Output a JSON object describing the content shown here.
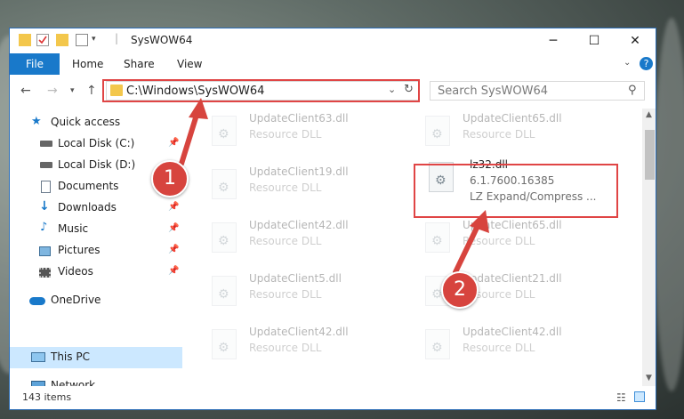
{
  "window": {
    "title": "SysWOW64"
  },
  "ribbon": {
    "tabs": [
      "File",
      "Home",
      "Share",
      "View"
    ]
  },
  "address": {
    "path": "C:\\Windows\\SysWOW64"
  },
  "search": {
    "placeholder": "Search SysWOW64"
  },
  "sidebar": {
    "items": [
      {
        "label": "Quick access",
        "icon": "star-icon"
      },
      {
        "label": "Local Disk (C:)",
        "icon": "drive-icon",
        "pinned": true
      },
      {
        "label": "Local Disk (D:)",
        "icon": "drive-icon"
      },
      {
        "label": "Documents",
        "icon": "documents-icon",
        "pinned": true
      },
      {
        "label": "Downloads",
        "icon": "download-arrow-icon",
        "pinned": true
      },
      {
        "label": "Music",
        "icon": "music-note-icon",
        "pinned": true
      },
      {
        "label": "Pictures",
        "icon": "pictures-icon",
        "pinned": true
      },
      {
        "label": "Videos",
        "icon": "film-icon",
        "pinned": true
      },
      {
        "label": "OneDrive",
        "icon": "cloud-icon"
      },
      {
        "label": "This PC",
        "icon": "monitor-icon",
        "selected": true
      },
      {
        "label": "Network",
        "icon": "network-icon"
      }
    ]
  },
  "files": {
    "left": [
      {
        "name": "UpdateClient63.dll",
        "type": "Resource DLL"
      },
      {
        "name": "UpdateClient19.dll",
        "type": "Resource DLL"
      },
      {
        "name": "UpdateClient42.dll",
        "type": "Resource DLL"
      },
      {
        "name": "UpdateClient5.dll",
        "type": "Resource DLL"
      },
      {
        "name": "UpdateClient42.dll",
        "type": "Resource DLL"
      }
    ],
    "right": [
      {
        "name": "UpdateClient65.dll",
        "type": "Resource DLL"
      },
      {
        "name": "lz32.dll",
        "version": "6.1.7600.16385",
        "type": "LZ Expand/Compress ..."
      },
      {
        "name": "UpdateClient65.dll",
        "type": "Resource DLL"
      },
      {
        "name": "UpdateClient21.dll",
        "type": "Resource DLL"
      },
      {
        "name": "UpdateClient42.dll",
        "type": "Resource DLL"
      }
    ]
  },
  "status": {
    "item_count": "143 items"
  },
  "callouts": [
    "1",
    "2"
  ],
  "colors": {
    "accent": "#1979ca",
    "highlight": "#e04545",
    "callout": "#d7443e"
  }
}
